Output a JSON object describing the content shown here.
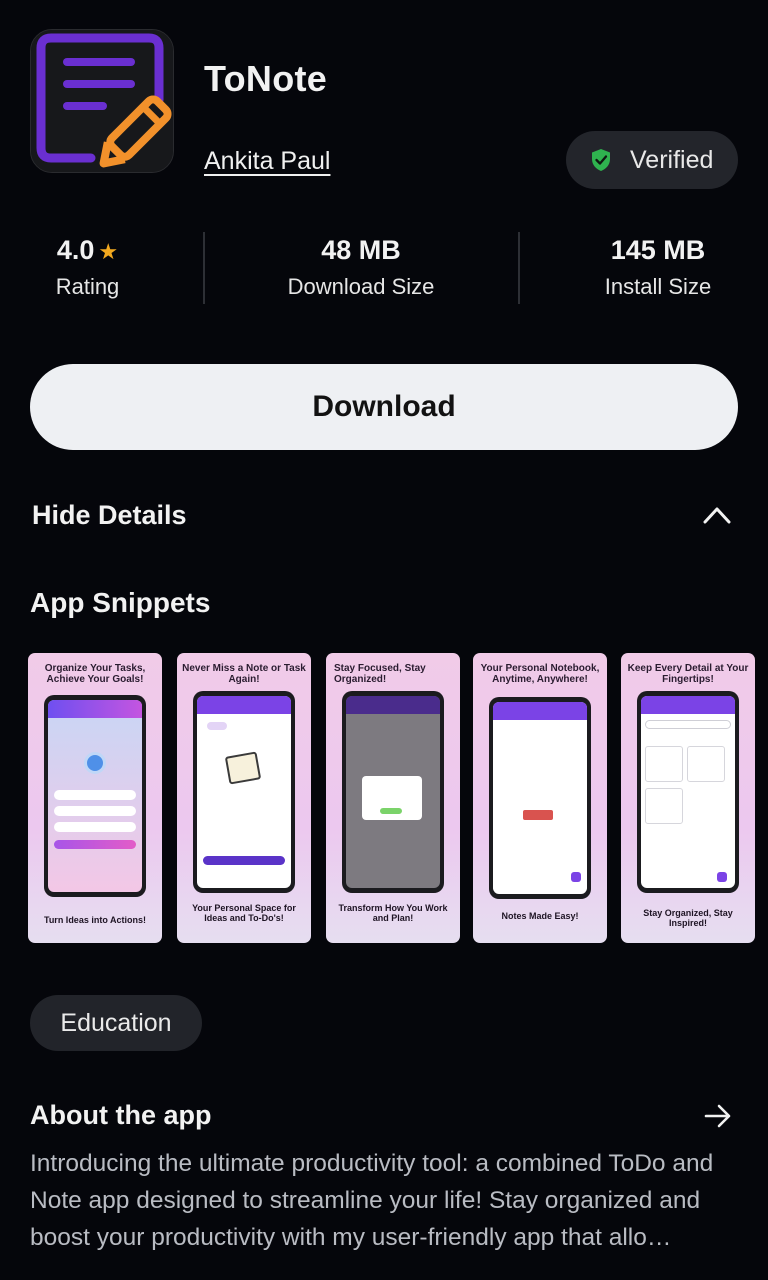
{
  "app": {
    "title": "ToNote",
    "developer": "Ankita Paul",
    "verified_label": "Verified",
    "icon": "note-pencil-icon"
  },
  "stats": {
    "rating": {
      "value": "4.0",
      "star": "★",
      "label": "Rating"
    },
    "download_size": {
      "value": "48 MB",
      "label": "Download Size"
    },
    "install_size": {
      "value": "145 MB",
      "label": "Install Size"
    }
  },
  "download_label": "Download",
  "details_toggle": "Hide Details",
  "snippets": {
    "title": "App Snippets",
    "items": [
      {
        "top": "Organize Your Tasks, Achieve Your Goals!",
        "bottom": "Turn Ideas into Actions!"
      },
      {
        "top": "Never Miss a Note or Task Again!",
        "bottom": "Your Personal Space for Ideas and To-Do's!"
      },
      {
        "top": "Stay Focused, Stay Organized!",
        "bottom": "Transform How You Work and Plan!"
      },
      {
        "top": "Your Personal Notebook, Anytime, Anywhere!",
        "bottom": "Notes Made Easy!"
      },
      {
        "top": "Keep Every Detail at Your Fingertips!",
        "bottom": "Stay Organized, Stay Inspired!"
      }
    ]
  },
  "category": "Education",
  "about": {
    "title": "About the app",
    "text": "Introducing the ultimate productivity tool: a combined ToDo and Note app designed to streamline your life! Stay organized and boost your productivity with my user-friendly app that allo…"
  },
  "colors": {
    "background": "#05060b",
    "accent_purple": "#7b43e6",
    "star": "#f2a81f",
    "verified_shield": "#2fb34f"
  }
}
